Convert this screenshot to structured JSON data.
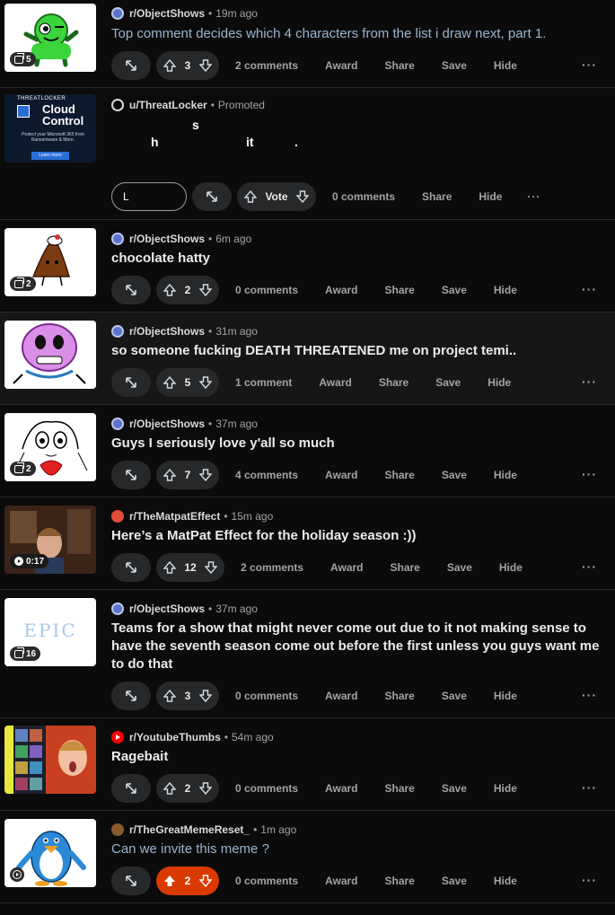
{
  "labels": {
    "award": "Award",
    "share": "Share",
    "save": "Save",
    "hide": "Hide",
    "more": "···"
  },
  "colors": {
    "background": "#0b0b0b",
    "upvote_active": "#d93a00",
    "visited_title": "#9ab3cf"
  },
  "posts": [
    {
      "subreddit": "r/ObjectShows",
      "time": "19m ago",
      "title": "Top comment decides which 4 characters from the list i draw next, part 1.",
      "votes": "3",
      "comments": "2 comments",
      "gallery_count": "5",
      "thumb_icon": "green-character-thumbnail"
    },
    {
      "subreddit": "u/ThreatLocker",
      "promoted": "Promoted",
      "ad_text": {
        "line1": "s",
        "line2a": "h",
        "line2b": "it",
        "line2c": "."
      },
      "input_value": "L",
      "vote_label": "Vote",
      "comments": "0 comments",
      "thumb": {
        "brand": "THREATLOCKER",
        "headline1": "Cloud",
        "headline2": "Control",
        "body": "Protect your Microsoft 365 from Ransomware & More.",
        "cta": "Learn more"
      }
    },
    {
      "subreddit": "r/ObjectShows",
      "time": "6m ago",
      "title": "chocolate hatty",
      "votes": "2",
      "comments": "0 comments",
      "gallery_count": "2",
      "thumb_icon": "chocolate-hat-thumbnail"
    },
    {
      "subreddit": "r/ObjectShows",
      "time": "31m ago",
      "title": "so someone fucking DEATH THREATENED me on project temi..",
      "votes": "5",
      "comments": "1 comment",
      "thumb_icon": "purple-character-thumbnail"
    },
    {
      "subreddit": "r/ObjectShows",
      "time": "37m ago",
      "title": "Guys I seriously love y'all so much",
      "votes": "7",
      "comments": "4 comments",
      "gallery_count": "2",
      "thumb_icon": "sketch-character-thumbnail"
    },
    {
      "subreddit": "r/TheMatpatEffect",
      "time": "15m ago",
      "title": "Here’s a MatPat Effect for the holiday season :))",
      "votes": "12",
      "comments": "2 comments",
      "video_duration": "0:17",
      "thumb_icon": "movie-still-thumbnail"
    },
    {
      "subreddit": "r/ObjectShows",
      "time": "37m ago",
      "title": "Teams for a show that might never come out due to it not making sense to have the seventh season come out before the first unless you guys want me to do that",
      "votes": "3",
      "comments": "0 comments",
      "gallery_count": "16",
      "thumb_text": "EPIC"
    },
    {
      "subreddit": "r/YoutubeThumbs",
      "time": "54m ago",
      "title": "Ragebait",
      "votes": "2",
      "comments": "0 comments",
      "thumb_icon": "youtube-collage-thumbnail"
    },
    {
      "subreddit": "r/TheGreatMemeReset_",
      "time": "1m ago",
      "title": "Can we invite this meme ?",
      "votes": "2",
      "comments": "0 comments",
      "thumb_icon": "penguin-thumbnail"
    }
  ]
}
